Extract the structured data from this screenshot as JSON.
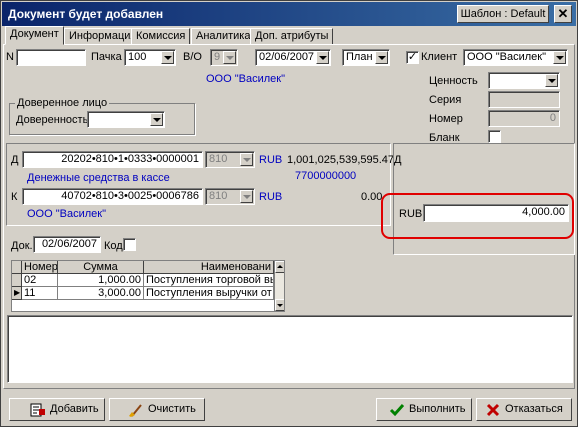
{
  "window": {
    "title": "Документ будет добавлен",
    "template_button": "Шаблон : Default",
    "close_glyph": "✕"
  },
  "tabs": [
    "Документ",
    "Информация",
    "Комиссия",
    "Аналитика",
    "Доп. атрибуты"
  ],
  "row1": {
    "n_label": "N",
    "n_value": "",
    "batch_label": "Пачка",
    "batch_value": "100",
    "vo_label": "В/О",
    "vo_value": "9",
    "date_value": "02/06/2007",
    "plan_value": "План",
    "client_checked": "✓",
    "client_label": "Клиент",
    "client_value": "ООО \"Василек\""
  },
  "client_name_display": "ООО \"Василек\"",
  "trustee": {
    "group_label": "Доверенное лицо",
    "field_label": "Доверенность",
    "field_value": ""
  },
  "valuable": {
    "value_label": "Ценность",
    "value_value": "",
    "series_label": "Серия",
    "series_value": "",
    "number_label": "Номер",
    "number_value": "0",
    "blank_label": "Бланк"
  },
  "debit": {
    "label": "Д",
    "account": "20202•810•1•0333•0000001",
    "currency_code": "810",
    "currency": "RUB",
    "amount": "1,001,025,539,595.47Д",
    "account_name": "Денежные средства в кассе",
    "inn": "7700000000"
  },
  "credit": {
    "label": "К",
    "account": "40702•810•3•0025•0006786",
    "currency_code": "810",
    "currency": "RUB",
    "amount": "0.00",
    "account_name": "ООО \"Василек\""
  },
  "amount_panel": {
    "currency": "RUB",
    "amount": "4,000.00"
  },
  "doc": {
    "date_label": "Док.",
    "date_value": "02/06/2007",
    "code_label": "Код"
  },
  "table": {
    "columns": [
      "Номер",
      "Сумма",
      "Наименовани"
    ],
    "rows": [
      {
        "number": "02",
        "sum": "1,000.00",
        "name": "Поступления торговой выр"
      },
      {
        "number": "11",
        "sum": "3,000.00",
        "name": "Поступления выручки от ре"
      }
    ],
    "current_row_marker": "▶"
  },
  "buttons": {
    "add": "Добавить",
    "clear": "Очистить",
    "execute": "Выполнить",
    "cancel": "Отказаться"
  },
  "colors": {
    "title_bar": "#0a246a",
    "highlight_frame": "#e00000",
    "link_text": "#0000c0",
    "face": "#d4d0c8"
  }
}
